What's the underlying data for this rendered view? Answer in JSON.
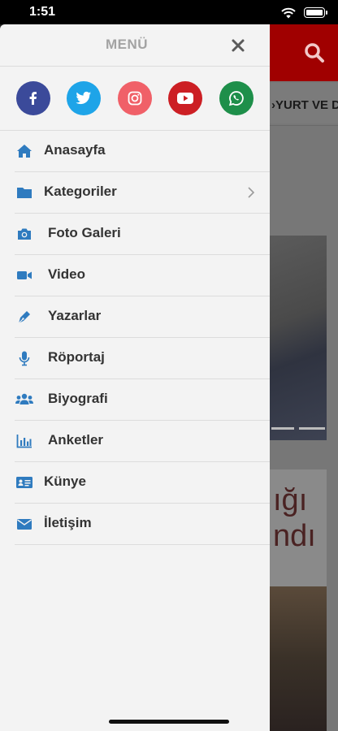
{
  "status_bar": {
    "time": "1:51"
  },
  "background": {
    "nav_text": "YURT VE D",
    "card_text_line1": "ığı",
    "card_text_line2": "ndı"
  },
  "menu": {
    "title": "MENÜ",
    "socials": [
      {
        "name": "facebook",
        "color": "#3b4a9a"
      },
      {
        "name": "twitter",
        "color": "#1ea4e8"
      },
      {
        "name": "instagram",
        "color": "#f06068"
      },
      {
        "name": "youtube",
        "color": "#cc1f24"
      },
      {
        "name": "whatsapp",
        "color": "#1e8f4a"
      }
    ],
    "items": [
      {
        "label": "Anasayfa",
        "icon": "home-icon"
      },
      {
        "label": "Kategoriler",
        "icon": "folder-icon",
        "has_submenu": true
      },
      {
        "label": "Foto Galeri",
        "icon": "camera-icon"
      },
      {
        "label": "Video",
        "icon": "video-icon"
      },
      {
        "label": "Yazarlar",
        "icon": "pen-icon"
      },
      {
        "label": "Röportaj",
        "icon": "microphone-icon"
      },
      {
        "label": "Biyografi",
        "icon": "users-icon"
      },
      {
        "label": "Anketler",
        "icon": "chart-icon"
      },
      {
        "label": "Künye",
        "icon": "id-card-icon"
      },
      {
        "label": "İletişim",
        "icon": "envelope-icon"
      }
    ]
  },
  "colors": {
    "icon_blue": "#2f7bbf",
    "header_red": "#a00000"
  }
}
